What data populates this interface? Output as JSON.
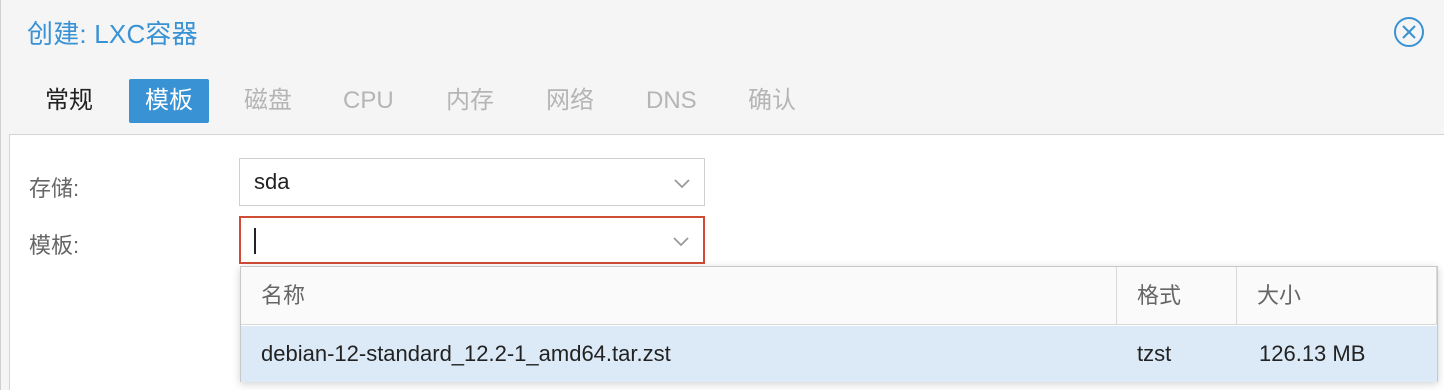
{
  "dialog": {
    "title": "创建: LXC容器",
    "close_icon": "close-circle-icon",
    "accent_color": "#3892d4"
  },
  "tabs": [
    {
      "label": "常规",
      "state": "enabled"
    },
    {
      "label": "模板",
      "state": "active"
    },
    {
      "label": "磁盘",
      "state": "disabled"
    },
    {
      "label": "CPU",
      "state": "disabled"
    },
    {
      "label": "内存",
      "state": "disabled"
    },
    {
      "label": "网络",
      "state": "disabled"
    },
    {
      "label": "DNS",
      "state": "disabled"
    },
    {
      "label": "确认",
      "state": "disabled"
    }
  ],
  "form": {
    "storage": {
      "label": "存储:",
      "value": "sda"
    },
    "template": {
      "label": "模板:",
      "value": "",
      "invalid_color": "#cf4c35"
    }
  },
  "template_list": {
    "columns": [
      "名称",
      "格式",
      "大小"
    ],
    "rows": [
      {
        "name": "debian-12-standard_12.2-1_amd64.tar.zst",
        "format": "tzst",
        "size": "126.13 MB"
      }
    ],
    "selected_color": "#dceaf7"
  }
}
